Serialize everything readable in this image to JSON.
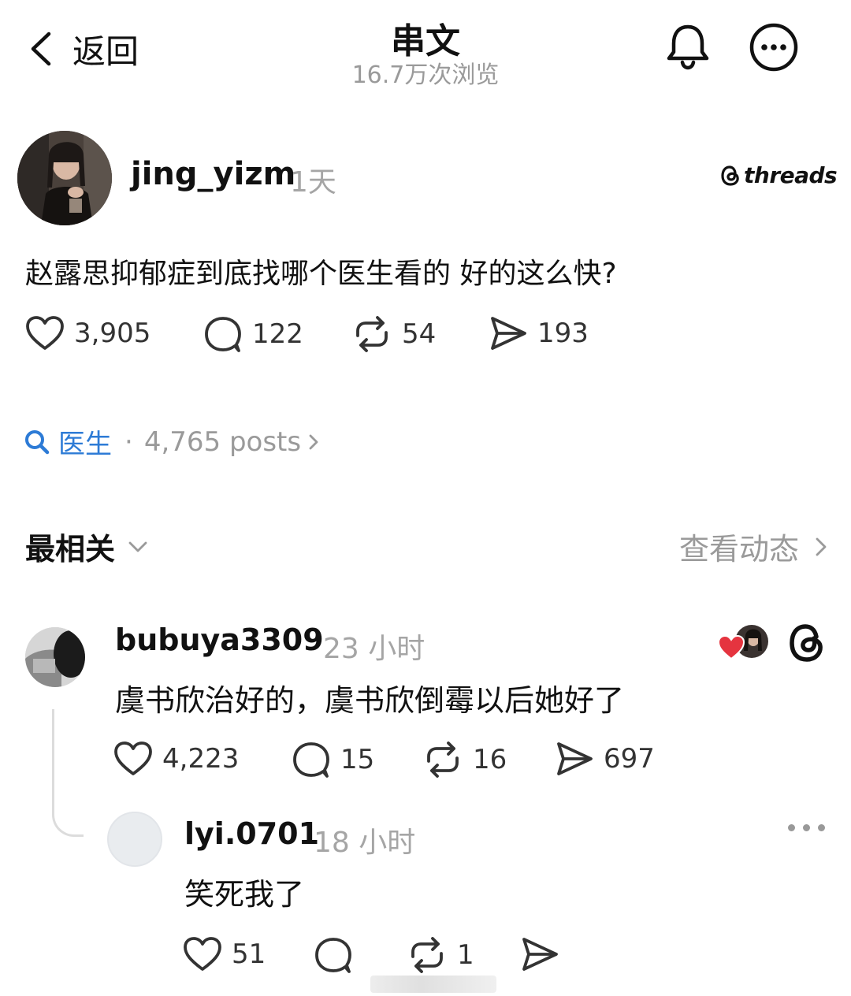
{
  "header": {
    "back_label": "返回",
    "title": "串文",
    "views": "16.7万次浏览"
  },
  "post": {
    "username": "jing_yizm",
    "time": "1天",
    "brand": "threads",
    "text": "赵露思抑郁症到底找哪个医生看的 好的这么快?",
    "likes": "3,905",
    "comments": "122",
    "reposts": "54",
    "shares": "193"
  },
  "tag": {
    "name": "医生",
    "separator": "·",
    "count": "4,765 posts"
  },
  "sort": {
    "label": "最相关",
    "activity_label": "查看动态"
  },
  "comments": [
    {
      "username": "bubuya3309",
      "time": "23 小时",
      "text": "虞书欣治好的，虞书欣倒霉以后她好了",
      "likes": "4,223",
      "comments": "15",
      "reposts": "16",
      "shares": "697"
    },
    {
      "username": "lyi.0701",
      "time": "18 小时",
      "text": "笑死我了",
      "likes": "51",
      "reposts": "1"
    }
  ],
  "colors": {
    "accent_blue": "#2d7bd6",
    "muted_gray": "#9a9a9a",
    "like_red": "#e5343f"
  }
}
